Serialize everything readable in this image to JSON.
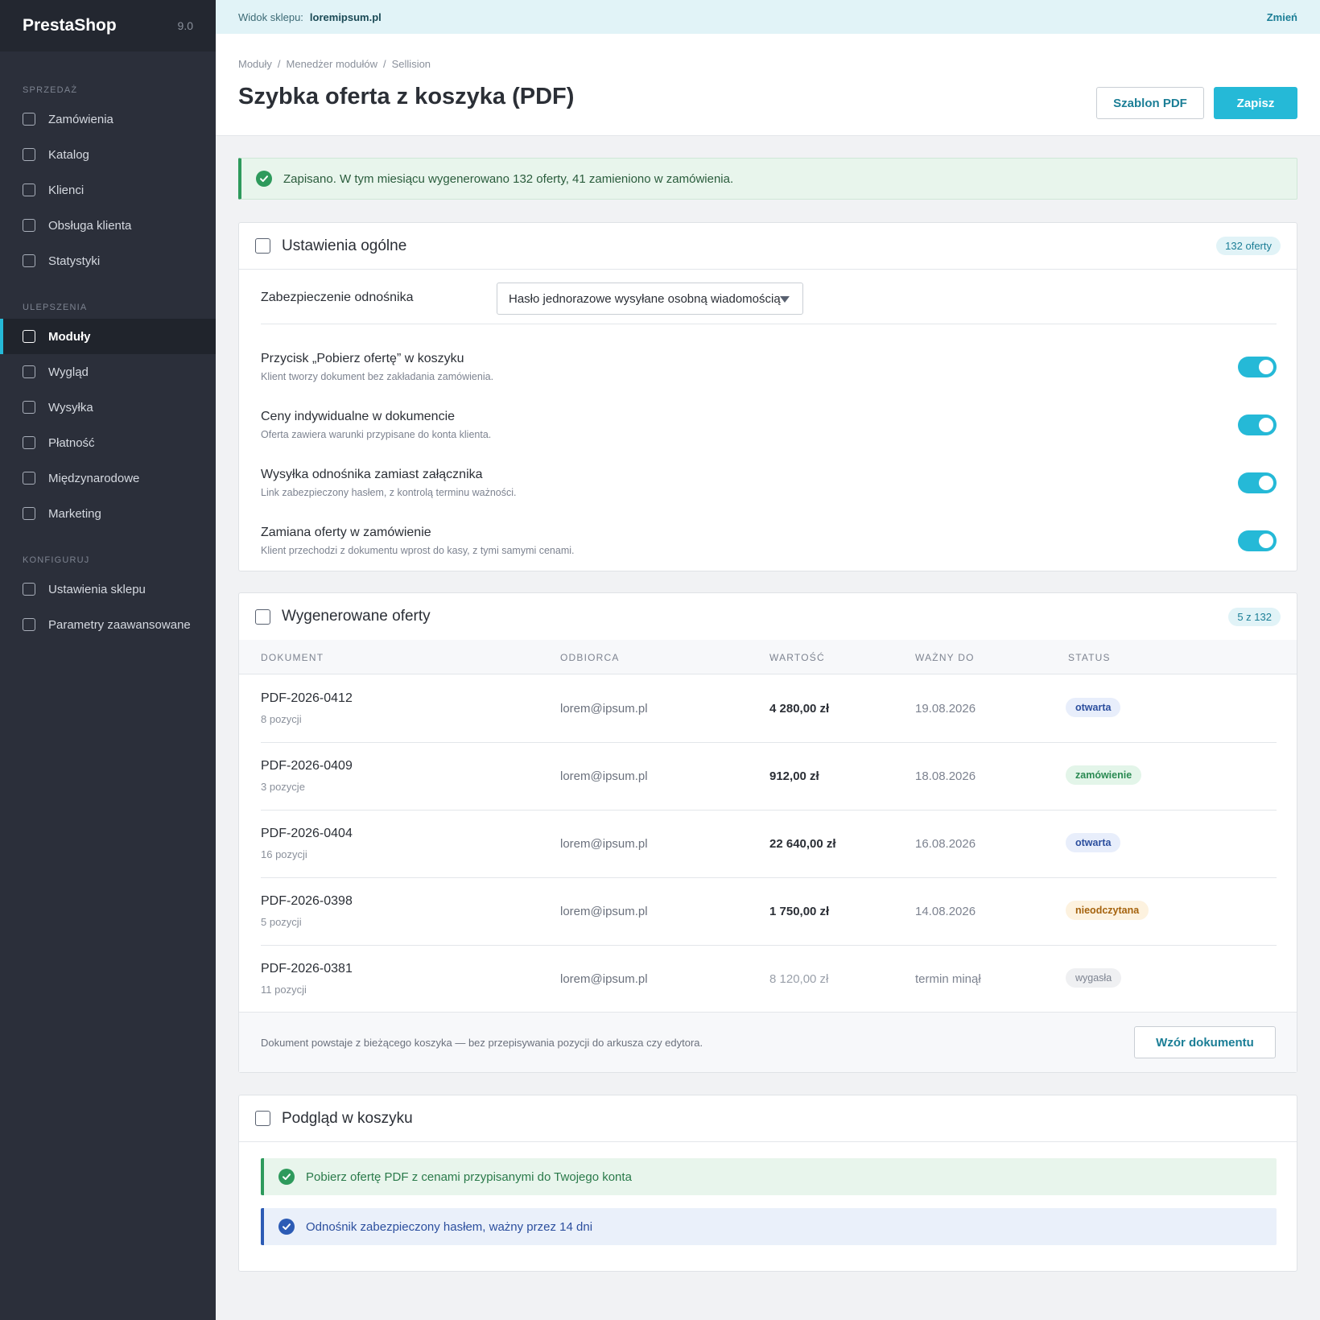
{
  "sidebar": {
    "brand": "PrestaShop",
    "version": "9.0",
    "sections": [
      {
        "title": "SPRZEDAŻ",
        "items": [
          "Zamówienia",
          "Katalog",
          "Klienci",
          "Obsługa klienta",
          "Statystyki"
        ]
      },
      {
        "title": "ULEPSZENIA",
        "items": [
          "Moduły",
          "Wygląd",
          "Wysyłka",
          "Płatność",
          "Międzynarodowe",
          "Marketing"
        ]
      },
      {
        "title": "KONFIGURUJ",
        "items": [
          "Ustawienia sklepu",
          "Parametry zaawansowane"
        ]
      }
    ],
    "active_item": "Moduły"
  },
  "topbar": {
    "label": "Widok sklepu:",
    "url": "loremipsum.pl",
    "change": "Zmień"
  },
  "header": {
    "breadcrumb": [
      "Moduły",
      "Menedżer modułów",
      "Sellision"
    ],
    "title": "Szybka oferta z koszyka (PDF)",
    "btn_template": "Szablon PDF",
    "btn_save": "Zapisz"
  },
  "alert": {
    "text": "Zapisano. W tym miesiącu wygenerowano 132 oferty, 41 zamieniono w zamówienia."
  },
  "settings": {
    "title": "Ustawienia ogólne",
    "badge": "132 oferty",
    "select_label": "Zabezpieczenie odnośnika",
    "select_value": "Hasło jednorazowe wysyłane osobną wiadomością",
    "toggles": [
      {
        "title": "Przycisk „Pobierz ofertę” w koszyku",
        "desc": "Klient tworzy dokument bez zakładania zamówienia.",
        "on": true
      },
      {
        "title": "Ceny indywidualne w dokumencie",
        "desc": "Oferta zawiera warunki przypisane do konta klienta.",
        "on": true
      },
      {
        "title": "Wysyłka odnośnika zamiast załącznika",
        "desc": "Link zabezpieczony hasłem, z kontrolą terminu ważności.",
        "on": true
      },
      {
        "title": "Zamiana oferty w zamówienie",
        "desc": "Klient przechodzi z dokumentu wprost do kasy, z tymi samymi cenami.",
        "on": true
      }
    ]
  },
  "offers": {
    "title": "Wygenerowane oferty",
    "badge": "5 z 132",
    "columns": [
      "DOKUMENT",
      "ODBIORCA",
      "WARTOŚĆ",
      "WAŻNY DO",
      "STATUS"
    ],
    "rows": [
      {
        "doc": "PDF-2026-0412",
        "items": "8 pozycji",
        "email": "lorem@ipsum.pl",
        "value": "4 280,00 zł",
        "date": "19.08.2026",
        "status": "otwarta"
      },
      {
        "doc": "PDF-2026-0409",
        "items": "3 pozycje",
        "email": "lorem@ipsum.pl",
        "value": "912,00 zł",
        "date": "18.08.2026",
        "status": "zamówienie"
      },
      {
        "doc": "PDF-2026-0404",
        "items": "16 pozycji",
        "email": "lorem@ipsum.pl",
        "value": "22 640,00 zł",
        "date": "16.08.2026",
        "status": "otwarta"
      },
      {
        "doc": "PDF-2026-0398",
        "items": "5 pozycji",
        "email": "lorem@ipsum.pl",
        "value": "1 750,00 zł",
        "date": "14.08.2026",
        "status": "nieodczytana"
      },
      {
        "doc": "PDF-2026-0381",
        "items": "11 pozycji",
        "email": "lorem@ipsum.pl",
        "value": "8 120,00 zł",
        "date": "termin minął",
        "status": "wygasła"
      }
    ],
    "footer_note": "Dokument powstaje z bieżącego koszyka — bez przepisywania pozycji do arkusza czy edytora.",
    "footer_button": "Wzór dokumentu"
  },
  "preview": {
    "title": "Podgląd w koszyku",
    "notice_green": "Pobierz ofertę PDF z cenami przypisanymi do Twojego konta",
    "notice_blue": "Odnośnik zabezpieczony hasłem, ważny przez 14 dni"
  },
  "colors": {
    "accent": "#25b9d7",
    "sidebar": "#2b2f3a",
    "success": "#2e9a5c",
    "info": "#2c5bb5"
  }
}
